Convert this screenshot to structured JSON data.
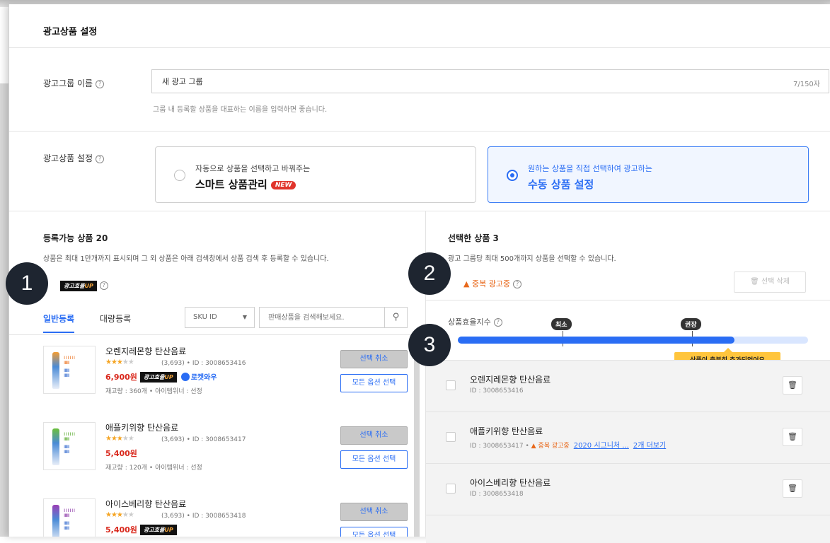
{
  "header": {
    "title": "광고상품 설정"
  },
  "group_name": {
    "label": "광고그룹 이름",
    "value": "새 광고 그룹",
    "count": "7/150자",
    "hint": "그룹 내 등록할 상품을 대표하는 이름을 입력하면 좋습니다."
  },
  "product_setting": {
    "label": "광고상품 설정",
    "options": [
      {
        "small": "자동으로 상품을 선택하고 바꿔주는",
        "big": "스마트 상품관리",
        "badge": "NEW",
        "selected": false
      },
      {
        "small": "원하는 상품을 직접 선택하여 광고하는",
        "big": "수동 상품 설정",
        "selected": true
      }
    ]
  },
  "left_panel": {
    "title": "등록가능 상품 20",
    "desc": "상품은 최대 1만개까지 표시되며 그 외 상품은 아래 검색창에서 상품 검색 후 등록할 수 있습니다.",
    "badge_text": "광고효율",
    "badge_up": "UP",
    "tabs": [
      "일반등록",
      "대량등록"
    ],
    "sku_select": "SKU ID",
    "search_placeholder": "판매상품을 검색해보세요.",
    "products": [
      {
        "name": "오렌지레몬향 탄산음료",
        "meta": "(3,693)  •  ID : 3008653416",
        "price": "6,900원",
        "rocket": "로켓와우",
        "stock": "재고량 : 360개  •  아이템위너 : 선정",
        "btn_cancel": "선택 취소",
        "btn_all": "모든 옵션 선택",
        "rating": 3.5
      },
      {
        "name": "애플키위향 탄산음료",
        "meta": "(3,693)  •  ID : 3008653417",
        "price": "5,400원",
        "stock": "재고량 : 120개  •  아이템위너 : 선정",
        "btn_cancel": "선택 취소",
        "btn_all": "모든 옵션 선택",
        "rating": 3.5
      },
      {
        "name": "아이스베리향 탄산음료",
        "meta": "(3,693)  •  ID : 3008653418",
        "price": "5,400원",
        "stock": "",
        "btn_cancel": "선택 취소",
        "btn_all": "모든 옵션 선택",
        "rating": 3.5
      }
    ]
  },
  "right_panel": {
    "title": "선택한 상품 3",
    "desc": "광고 그룹당 최대 500개까지 상품을 선택할 수 있습니다.",
    "dup_label": "▲ 중복 광고중",
    "delete_btn": "선택 삭제",
    "efficiency_label": "상품효율지수",
    "marker_min": "최소",
    "marker_rec": "권장",
    "efficiency_level": 0.79,
    "tooltip": "상품이 충분히 추가되었어요",
    "items": [
      {
        "name": "오렌지레몬향 탄산음료",
        "id": "ID : 3008653416"
      },
      {
        "name": "애플키위향 탄산음료",
        "id": "ID : 3008653417  •",
        "warn": "▲ 중복 광고중",
        "link1": "2020 시그니처 ...",
        "link2": "2개 더보기"
      },
      {
        "name": "아이스베리향 탄산음료",
        "id": "ID : 3008653418"
      }
    ]
  },
  "callouts": [
    "1",
    "2",
    "3"
  ],
  "colors": {
    "accent": "#2a6df4",
    "price": "#d9281c",
    "warning": "#e8691c",
    "tooltip": "#ffc53d"
  }
}
